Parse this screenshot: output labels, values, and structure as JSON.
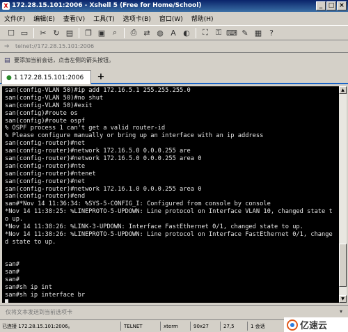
{
  "window": {
    "title": "172.28.15.101:2006 - Xshell 5 (Free for Home/School)",
    "controls": [
      "_",
      "□",
      "×"
    ]
  },
  "menu": [
    "文件(F)",
    "编辑(E)",
    "查看(V)",
    "工具(T)",
    "选项卡(B)",
    "窗口(W)",
    "帮助(H)"
  ],
  "toolbar": {
    "icons": [
      "new-session-icon",
      "open-folder-icon",
      "disconnect-icon",
      "reconnect-icon",
      "properties-icon",
      "copy-icon",
      "paste-icon",
      "find-icon",
      "print-icon",
      "transfer-icon",
      "globe-icon",
      "font-icon",
      "color-scheme-icon",
      "fullscreen-icon",
      "lock-icon",
      "keyboard-icon",
      "script-icon",
      "compose-icon",
      "help-icon"
    ]
  },
  "address": {
    "text": "telnet://172.28.15.101:2006"
  },
  "hint": {
    "text": "要添加当前会话，点击左侧的箭头按钮。"
  },
  "tabs": {
    "active_label": "1 172.28.15.101:2006",
    "add_label": "+"
  },
  "terminal": {
    "lines": [
      "san(config-VLAN 50)#ip add 172.16.5.1 255.255.255.0",
      "san(config-VLAN 50)#no shut",
      "san(config-VLAN 50)#exit",
      "san(config)#route os",
      "san(config)#route ospf",
      "% OSPF process 1 can't get a valid router-id",
      "% Please configure manually or bring up an interface with an ip address",
      "san(config-router)#net",
      "san(config-router)#network 172.16.5.0 0.0.0.255 are",
      "san(config-router)#network 172.16.5.0 0.0.0.255 area 0",
      "san(config-router)#nte",
      "san(config-router)#ntenet",
      "san(config-router)#net",
      "san(config-router)#network 172.16.1.0 0.0.0.255 area 0",
      "san(config-router)#end",
      "san#*Nov 14 11:36:34: %SYS-5-CONFIG_I: Configured from console by console",
      "*Nov 14 11:38:25: %LINEPROTO-5-UPDOWN: Line protocol on Interface VLAN 10, changed state t",
      "o up.",
      "*Nov 14 11:38:26: %LINK-3-UPDOWN: Interface FastEthernet 0/1, changed state to up.",
      "*Nov 14 11:38:26: %LINEPROTO-5-UPDOWN: Line protocol on Interface FastEthernet 0/1, change",
      "d state to up.",
      "",
      "",
      "san#",
      "san#",
      "san#",
      "san#sh ip int",
      "san#sh ip interface br",
      ""
    ]
  },
  "input_bar": {
    "placeholder": "仅将文本发送到当前选项卡"
  },
  "status": {
    "connection": "已连接 172.28.15.101:2006。",
    "protocol": "TELNET",
    "terminal_type": "xterm",
    "size": "90x27",
    "cursor_pos": "27,5",
    "sessions": "1 会话"
  },
  "watermark": {
    "text": "亿速云"
  }
}
